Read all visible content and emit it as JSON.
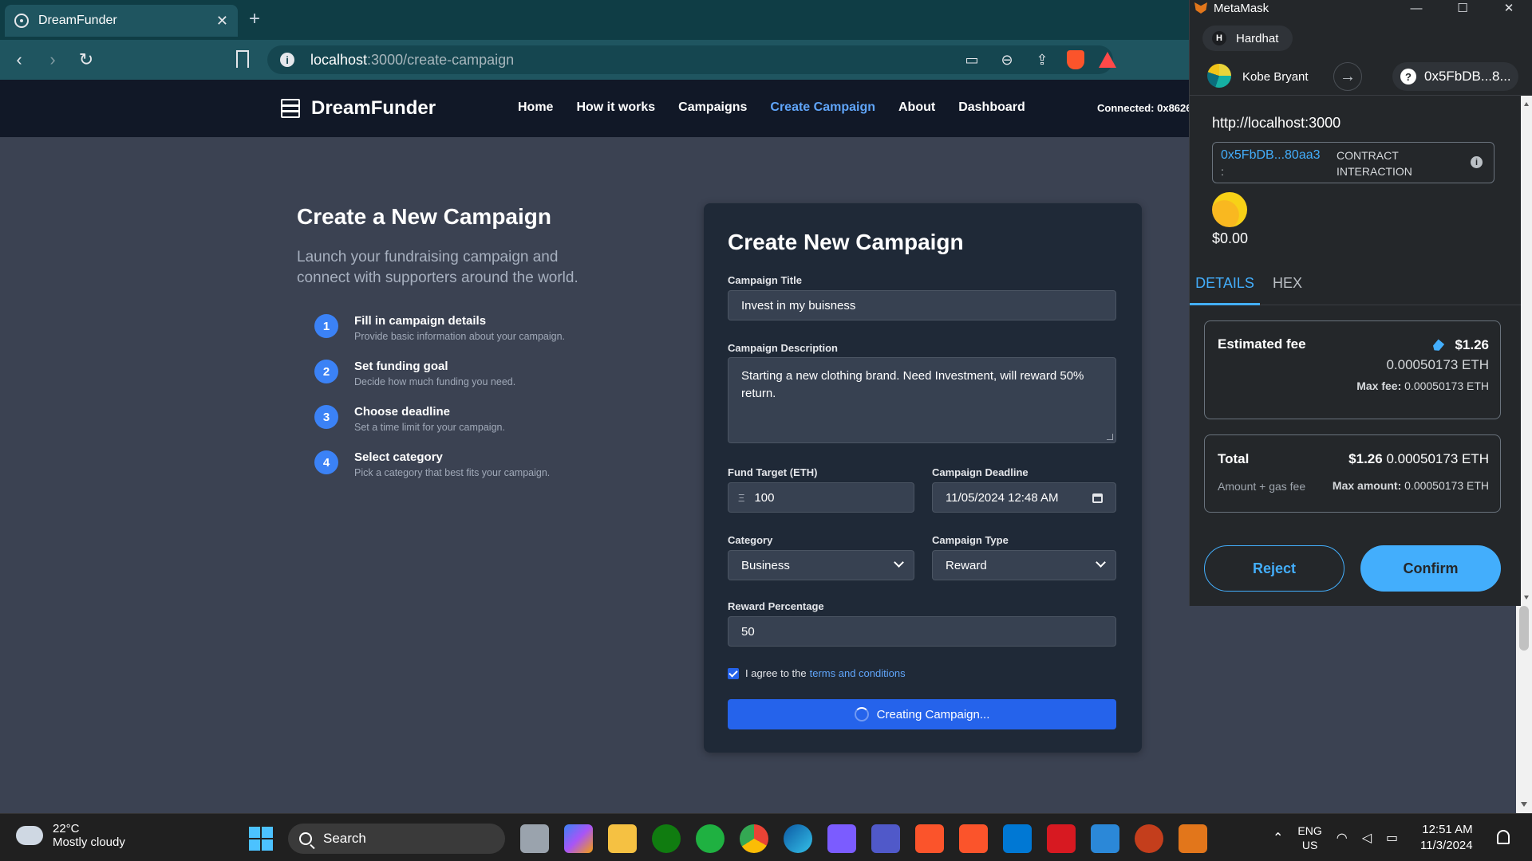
{
  "browser": {
    "tab_title": "DreamFunder",
    "url_host": "localhost",
    "url_path": ":3000/create-campaign"
  },
  "site": {
    "brand": "DreamFunder",
    "nav": [
      "Home",
      "How it works",
      "Campaigns",
      "Create Campaign",
      "About",
      "Dashboard"
    ],
    "active_nav": "Create Campaign",
    "connected": "Connected: 0x8626"
  },
  "intro": {
    "title": "Create a New Campaign",
    "subtitle": "Launch your fundraising campaign and connect with supporters around the world.",
    "steps": [
      {
        "num": "1",
        "title": "Fill in campaign details",
        "desc": "Provide basic information about your campaign."
      },
      {
        "num": "2",
        "title": "Set funding goal",
        "desc": "Decide how much funding you need."
      },
      {
        "num": "3",
        "title": "Choose deadline",
        "desc": "Set a time limit for your campaign."
      },
      {
        "num": "4",
        "title": "Select category",
        "desc": "Pick a category that best fits your campaign."
      }
    ]
  },
  "form": {
    "heading": "Create New Campaign",
    "title_label": "Campaign Title",
    "title_value": "Invest in my buisness",
    "description_label": "Campaign Description",
    "description_value": "Starting a new clothing brand. Need Investment, will reward 50% return.",
    "target_label": "Fund Target (ETH)",
    "target_prefix": "Ξ",
    "target_value": "100",
    "deadline_label": "Campaign Deadline",
    "deadline_value": "11/05/2024 12:48 AM",
    "category_label": "Category",
    "category_value": "Business",
    "type_label": "Campaign Type",
    "type_value": "Reward",
    "reward_label": "Reward Percentage",
    "reward_value": "50",
    "agree_text": "I agree to the",
    "agree_link": "terms and conditions",
    "agree_checked": true,
    "submit_label": "Creating Campaign..."
  },
  "metamask": {
    "window_title": "MetaMask",
    "network_badge": "H",
    "network": "Hardhat",
    "account": "Kobe Bryant",
    "to_address": "0x5FbDB...8...",
    "origin": "http://localhost:3000",
    "contract_addr": "0x5FbDB...80aa3",
    "contract_colon": ":",
    "contract_type_1": "CONTRACT",
    "contract_type_2": "INTERACTION",
    "value": "$0.00",
    "tab_details": "DETAILS",
    "tab_hex": "HEX",
    "fee_label": "Estimated fee",
    "fee_usd": "$1.26",
    "fee_eth": "0.00050173 ETH",
    "max_fee_label": "Max fee:",
    "max_fee_value": "0.00050173 ETH",
    "total_label": "Total",
    "total_usd": "$1.26",
    "total_eth": "0.00050173 ETH",
    "total_sub": "Amount + gas fee",
    "max_amount_label": "Max amount:",
    "max_amount_value": "0.00050173 ETH",
    "reject": "Reject",
    "confirm": "Confirm"
  },
  "taskbar": {
    "temp": "22°C",
    "weather": "Mostly cloudy",
    "search": "Search",
    "lang_1": "ENG",
    "lang_2": "US",
    "time": "12:51 AM",
    "date": "11/3/2024"
  }
}
